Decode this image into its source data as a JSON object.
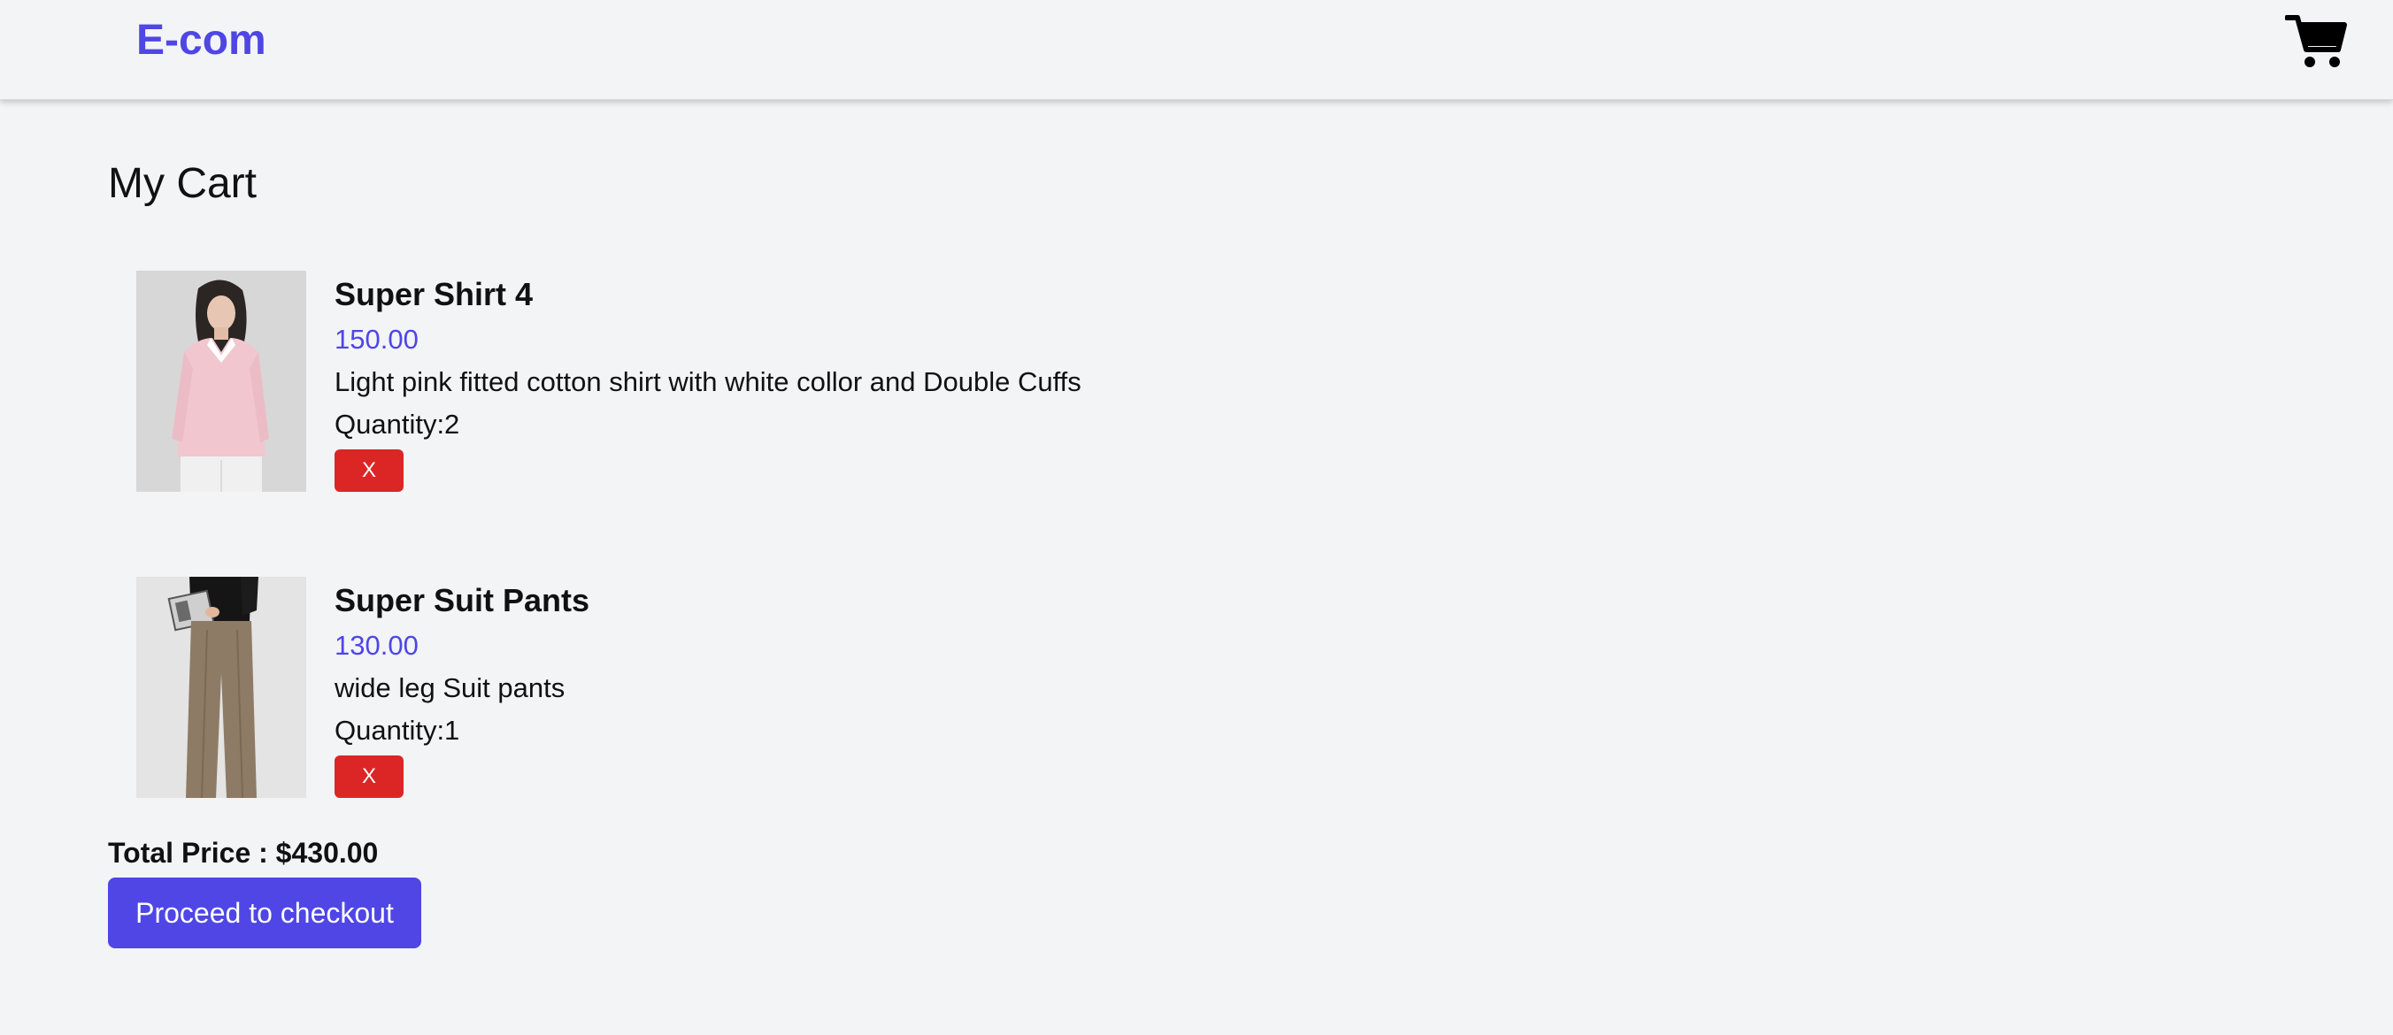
{
  "header": {
    "brand": "E-com",
    "cart_icon": "shopping-cart-icon"
  },
  "page": {
    "title": "My Cart"
  },
  "cart": {
    "items": [
      {
        "name": "Super Shirt 4",
        "price": "150.00",
        "description": "Light pink fitted cotton shirt with white collor and Double Cuffs",
        "quantity": "Quantity:2",
        "remove_label": "X"
      },
      {
        "name": "Super Suit Pants",
        "price": "130.00",
        "description": "wide leg Suit pants",
        "quantity": "Quantity:1",
        "remove_label": "X"
      }
    ],
    "total_label": "Total Price : $430.00",
    "checkout_label": "Proceed to checkout"
  },
  "colors": {
    "accent": "#4f46e5",
    "danger": "#dc2626",
    "background": "#f3f4f6"
  }
}
